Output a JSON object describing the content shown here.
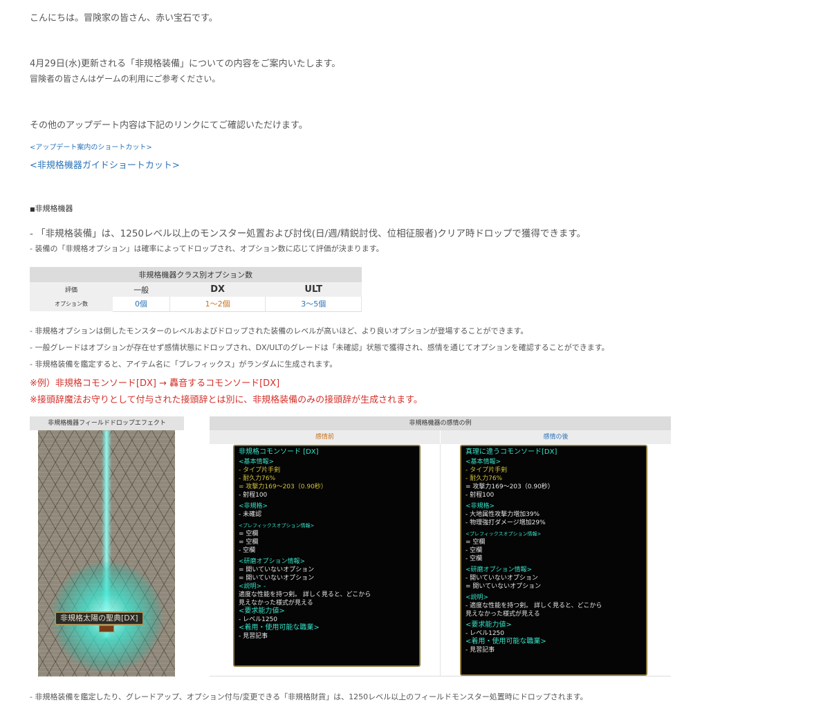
{
  "intro": {
    "greeting": "こんにちは。冒険家の皆さん、赤い宝石です。",
    "line1": "4月29日(水)更新される「非規格装備」についての内容をご案内いたします。",
    "line2": "冒険者の皆さんはゲームの利用にご参考ください。",
    "line3": "その他のアップデート内容は下記のリンクにてご確認いただけます。"
  },
  "links": {
    "update_shortcut": "<アップデート案内のショートカット>",
    "guide_shortcut": "<非規格機器ガイドショートカット>"
  },
  "section": {
    "bullet": "■",
    "title": "非規格機器",
    "desc1": "- 「非規格装備」は、1250レベル以上のモンスター処置および討伐(日/週/精鋭討伐、位相征服者)クリア時ドロップで獲得できます。",
    "desc2": "- 装備の「非規格オプション」は確率によってドロップされ、オプション数に応じて評価が決まります。"
  },
  "class_table": {
    "title": "非規格機器クラス別オプション数",
    "row_header": "評価",
    "grades": [
      "一般",
      "DX",
      "ULT"
    ],
    "row_label": "オプション数",
    "counts": [
      "0個",
      "1～2個",
      "3～5個"
    ],
    "count_colors": [
      "#2a73b8",
      "#c7731c",
      "#2a73b8"
    ]
  },
  "notes": {
    "n1": "- 非規格オプションは倒したモンスターのレベルおよびドロップされた装備のレベルが高いほど、より良いオプションが登場することができます。",
    "n2": "- 一般グレードはオプションが存在せず感情状態にドロップされ、DX/ULTのグレードは「未確認」状態で獲得され、感情を通じてオプションを確認することができます。",
    "n3": "- 非規格装備を鑑定すると、アイテム名に「プレフィックス」がランダムに生成されます。",
    "example": "※例）非規格コモンソード[DX] → 轟音するコモンソード[DX]",
    "warning": "※接頭辞魔法お守りとして付与された接頭辞とは別に、非規格装備のみの接頭辞が生成されます。",
    "footer": "- 非規格装備を鑑定したり、グレードアップ、オプション付与/変更できる「非規格財貨」は、1250レベル以上のフィールドモンスター処置時にドロップされます。"
  },
  "field_effect": {
    "title": "非規格機器フィールドドロップエフェクト",
    "item_name": "非規格太陽の聖典[DX]"
  },
  "appraisal": {
    "title": "非規格機器の感情の例",
    "before_label": "感情前",
    "after_label": "感情の後",
    "before": {
      "name": "非規格コモンソード [DX]",
      "basic": "<基本情報>",
      "type": "- タイプ片手剣",
      "durability": "- 耐久力76%",
      "attack": "= 攻撃力169～203（0.90秒）",
      "range": "- 射程100",
      "nonstd": "<非規格>",
      "nonstd_lines": [
        "- 未確認"
      ],
      "prefix": "<プレフィックスオプション情報>",
      "prefix_lines": [
        "= 空欄",
        "= 空欄",
        "- 空欄"
      ],
      "polish": "<研磨オプション情報>",
      "polish_lines": [
        "= 開いていないオプション",
        "= 開いていないオプション"
      ],
      "desc_head": "<説明> -",
      "desc_lines": [
        "適度な性能を持つ剣。 詳しく見ると、どこから",
        "見えなかった様式が見える"
      ],
      "req": "<要求能力値>",
      "req_lines": [
        "- レベル1250"
      ],
      "job": "<着用・使用可能な職業>",
      "job_lines": [
        "- 見習記事"
      ]
    },
    "after": {
      "name": "真理に違うコモンソード[DX]",
      "basic": "<基本情報>",
      "type": "- タイプ片手剣",
      "durability": "- 耐久力76%",
      "attack": "= 攻撃力169～203（0.90秒）",
      "range": "- 射程100",
      "nonstd": "<非規格>",
      "nonstd_lines": [
        "- 大地属性攻撃力増加39%",
        "- 物理強打ダメージ増加29%"
      ],
      "prefix": "<プレフィックスオプション情報>",
      "prefix_lines": [
        "= 空欄",
        "- 空欄",
        "- 空欄"
      ],
      "polish": "<研磨オプション情報>",
      "polish_lines": [
        "- 開いていないオプション",
        "= 開いていないオプション"
      ],
      "desc_head": "<説明>",
      "desc_lines": [
        "- 適度な性能を持つ剣。 詳しく見ると、どこから",
        "見えなかった様式が見える"
      ],
      "req": "<要求能力値>",
      "req_lines": [
        "- レベル1250"
      ],
      "job": "<着用・使用可能な職業>",
      "job_lines": [
        "- 見習記事"
      ]
    }
  }
}
